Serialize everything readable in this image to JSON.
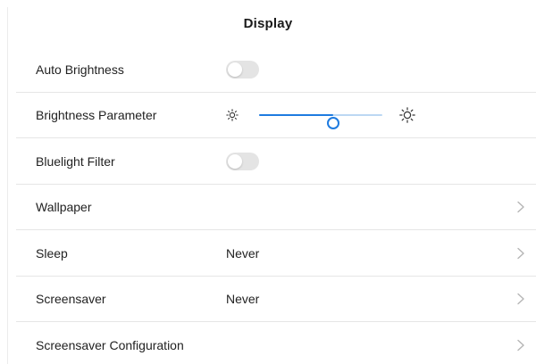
{
  "header": {
    "title": "Display"
  },
  "rows": [
    {
      "label": "Auto Brightness",
      "toggle_on": false
    },
    {
      "label": "Brightness Parameter",
      "brightness_level": 0.6
    },
    {
      "label": "Bluelight Filter",
      "toggle_on": false
    },
    {
      "label": "Wallpaper"
    },
    {
      "label": "Sleep",
      "value": "Never"
    },
    {
      "label": "Screensaver",
      "value": "Never"
    },
    {
      "label": "Screensaver Configuration"
    }
  ],
  "icons": {
    "chevron": "chevron-right-icon",
    "brightness_low": "sun-small-icon",
    "brightness_high": "sun-large-icon"
  },
  "colors": {
    "accent": "#1e7be0",
    "track_inactive": "#bcd8f3",
    "toggle_off": "#e4e4e4",
    "divider": "#e6e6e6",
    "chevron": "#b5b5b5"
  }
}
